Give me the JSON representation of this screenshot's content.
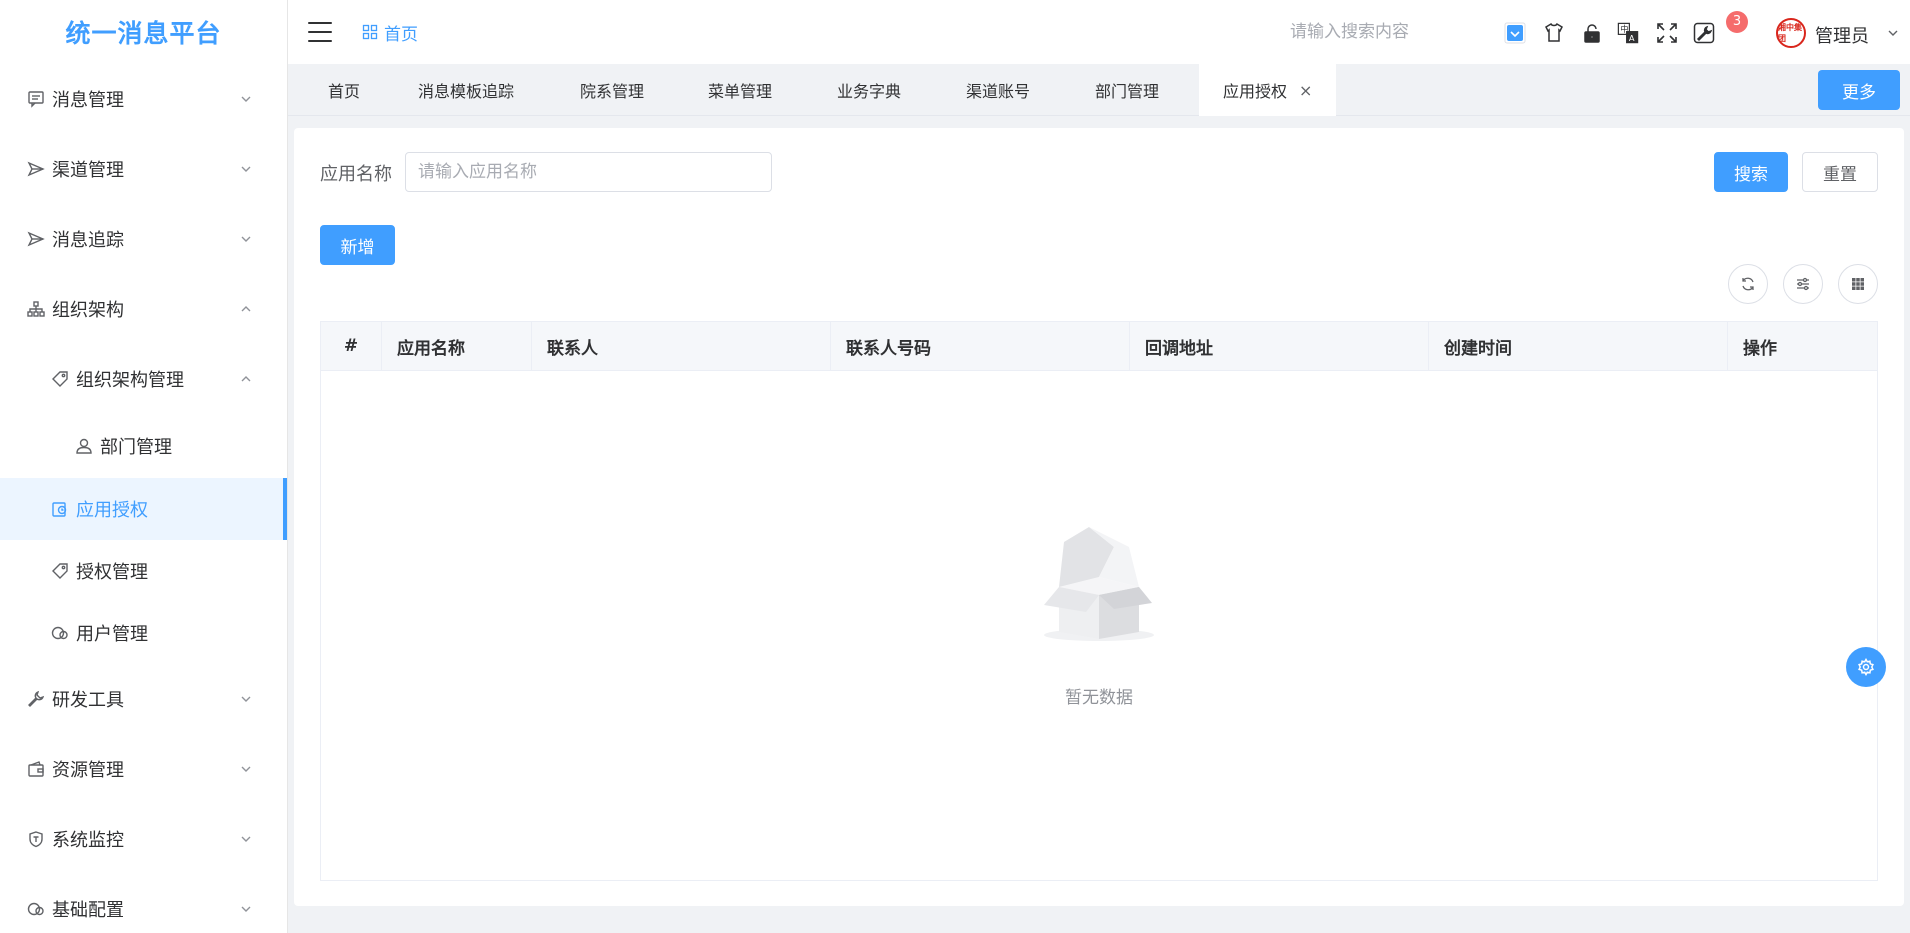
{
  "app": {
    "title": "统一消息平台"
  },
  "sidebar": {
    "items": [
      {
        "label": "消息管理",
        "icon": "message-icon"
      },
      {
        "label": "渠道管理",
        "icon": "send-icon"
      },
      {
        "label": "消息追踪",
        "icon": "send-icon"
      },
      {
        "label": "组织架构",
        "icon": "org-icon"
      },
      {
        "label": "组织架构管理",
        "icon": "tag-icon"
      },
      {
        "label": "部门管理",
        "icon": "user-icon"
      },
      {
        "label": "应用授权",
        "icon": "app-auth-icon"
      },
      {
        "label": "授权管理",
        "icon": "tag-icon"
      },
      {
        "label": "用户管理",
        "icon": "user-circle-icon"
      },
      {
        "label": "研发工具",
        "icon": "wrench-icon"
      },
      {
        "label": "资源管理",
        "icon": "wallet-icon"
      },
      {
        "label": "系统监控",
        "icon": "shield-icon"
      },
      {
        "label": "基础配置",
        "icon": "cloud-icon"
      }
    ]
  },
  "header": {
    "breadcrumb": "首页",
    "search_placeholder": "请输入搜索内容",
    "badge_count": "3",
    "user_name": "管理员",
    "avatar_text": "湘中集团"
  },
  "tags": {
    "items": [
      "首页",
      "消息模板追踪",
      "院系管理",
      "菜单管理",
      "业务字典",
      "渠道账号",
      "部门管理",
      "应用授权"
    ],
    "close_symbol": "×",
    "more_label": "更多"
  },
  "form": {
    "label": "应用名称",
    "input_placeholder": "请输入应用名称",
    "search_label": "搜索",
    "reset_label": "重置",
    "add_label": "新增"
  },
  "table": {
    "columns": [
      "#",
      "应用名称",
      "联系人",
      "联系人号码",
      "回调地址",
      "创建时间",
      "操作"
    ],
    "rows": [],
    "empty_text": "暂无数据"
  },
  "colors": {
    "primary": "#409eff",
    "badge": "#f56c6c",
    "active_bg": "#ecf5ff"
  }
}
